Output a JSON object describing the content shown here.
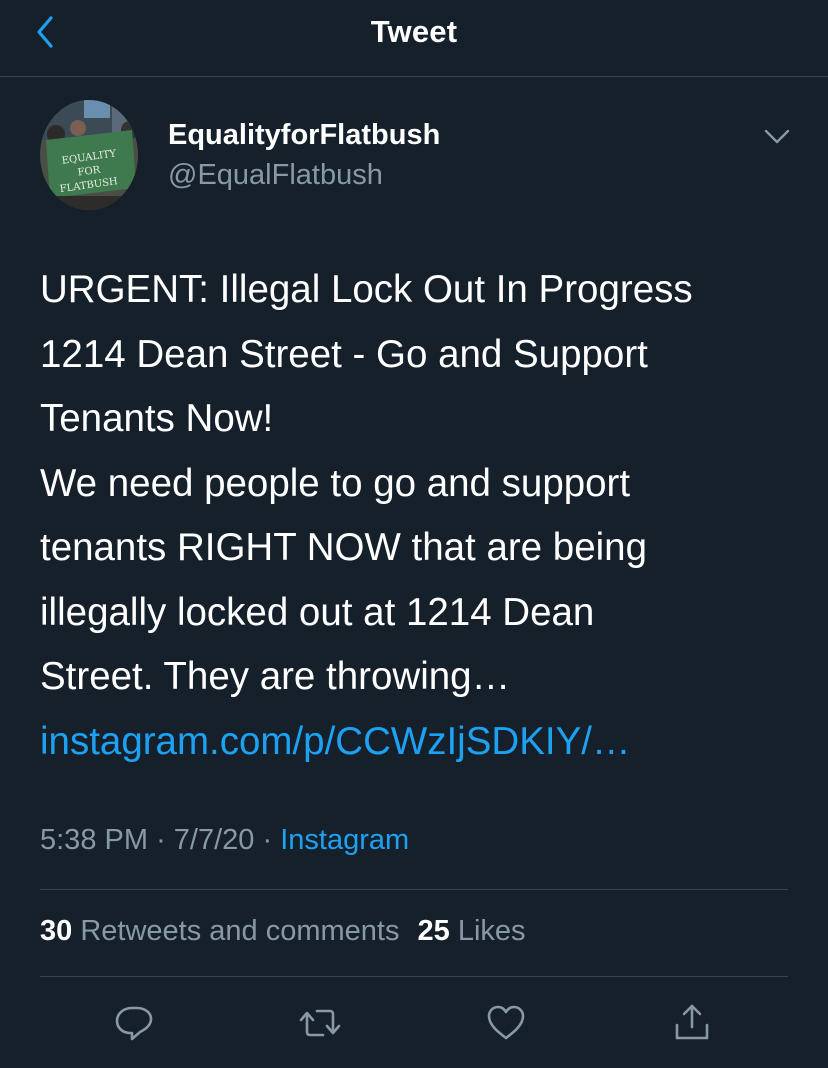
{
  "header": {
    "title": "Tweet"
  },
  "tweet": {
    "author": {
      "display_name": "EqualityforFlatbush",
      "handle": "@EqualFlatbush",
      "avatar_banner_text": [
        "EQUALITY",
        "FOR",
        "FLATBUSH"
      ]
    },
    "text_lines": [
      "URGENT: Illegal Lock Out In Progress",
      "1214 Dean Street - Go and Support",
      "Tenants Now!",
      "We need people to go and support",
      "tenants RIGHT NOW that are being",
      "illegally locked out at 1214 Dean",
      "Street. They are throwing…"
    ],
    "link": "instagram.com/p/CCWzIjSDKIY/…",
    "time": "5:38 PM",
    "separator": "·",
    "date": "7/7/20",
    "source": "Instagram"
  },
  "stats": {
    "retweets_count": "30",
    "retweets_label": "Retweets and comments",
    "likes_count": "25",
    "likes_label": "Likes"
  },
  "actions": {
    "icons": [
      "reply-icon",
      "retweet-icon",
      "like-icon",
      "share-icon"
    ]
  },
  "colors": {
    "background": "#15202b",
    "accent": "#1da1f2",
    "secondary_text": "#8899a6",
    "divider": "#38444d"
  }
}
